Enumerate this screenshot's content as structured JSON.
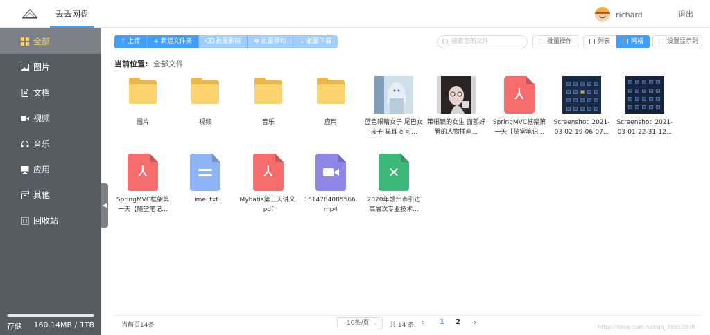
{
  "header": {
    "app_name": "丢丢网盘",
    "username": "richard",
    "logout_label": "退出"
  },
  "sidebar": {
    "items": [
      {
        "label": "全部",
        "icon": "grid-icon",
        "active": true
      },
      {
        "label": "图片",
        "icon": "image-icon"
      },
      {
        "label": "文档",
        "icon": "document-icon"
      },
      {
        "label": "视频",
        "icon": "video-icon"
      },
      {
        "label": "音乐",
        "icon": "headphones-icon"
      },
      {
        "label": "应用",
        "icon": "monitor-icon"
      },
      {
        "label": "其他",
        "icon": "archive-icon"
      },
      {
        "label": "回收站",
        "icon": "trash-icon"
      }
    ],
    "storage_label": "存储",
    "storage_value": "160.14MB / 1TB",
    "storage_used_fraction": 0.0002
  },
  "toolbar": {
    "upload": "上传",
    "new_folder": "新建文件夹",
    "batch_delete": "批量删除",
    "batch_move": "批量移动",
    "batch_download": "批量下载",
    "search_placeholder": "搜索您的文件",
    "batch_operation": "批量操作",
    "list_view": "列表",
    "grid_view": "网格",
    "display_columns": "设置显示列"
  },
  "location": {
    "label": "当前位置:",
    "value": "全部文件"
  },
  "files": [
    {
      "name": "图片",
      "type": "folder"
    },
    {
      "name": "视频",
      "type": "folder"
    },
    {
      "name": "音乐",
      "type": "folder"
    },
    {
      "name": "应用",
      "type": "folder"
    },
    {
      "name": "蓝色眼睛女子 尾巴女孩子 猫耳 è 可...",
      "type": "image"
    },
    {
      "name": "带眼镜的女生 面部好看的人物插画...",
      "type": "image"
    },
    {
      "name": "SpringMVC框架第一天【随堂笔记...",
      "type": "pdf"
    },
    {
      "name": "Screenshot_2021-03-02-19-06-07...",
      "type": "screenshot"
    },
    {
      "name": "Screenshot_2021-03-01-22-31-12...",
      "type": "screenshot"
    },
    {
      "name": "SpringMVC框架第一天【随堂笔记...",
      "type": "pdf"
    },
    {
      "name": ".imei.txt",
      "type": "text"
    },
    {
      "name": "Mybatis第三天讲义.pdf",
      "type": "pdf"
    },
    {
      "name": "1614784085566.mp4",
      "type": "video"
    },
    {
      "name": "2020年赣州市引进高层次专业技术...",
      "type": "excel"
    }
  ],
  "pagination": {
    "current_page_info": "当前页14条",
    "page_size": "10条/页",
    "total": "共 14 条",
    "pages": [
      "1",
      "2"
    ],
    "current_page": "1"
  },
  "watermark": "https://blog.csdn.net/qq_38953908",
  "colors": {
    "primary": "#409eff",
    "sidebar": "#545c64",
    "sidebar_active_text": "#ffd04b",
    "pdf": "#f56c6c",
    "text": "#8cb4f7",
    "video": "#8c86e6",
    "excel": "#3cb87a",
    "folder": "#fcd36f"
  }
}
